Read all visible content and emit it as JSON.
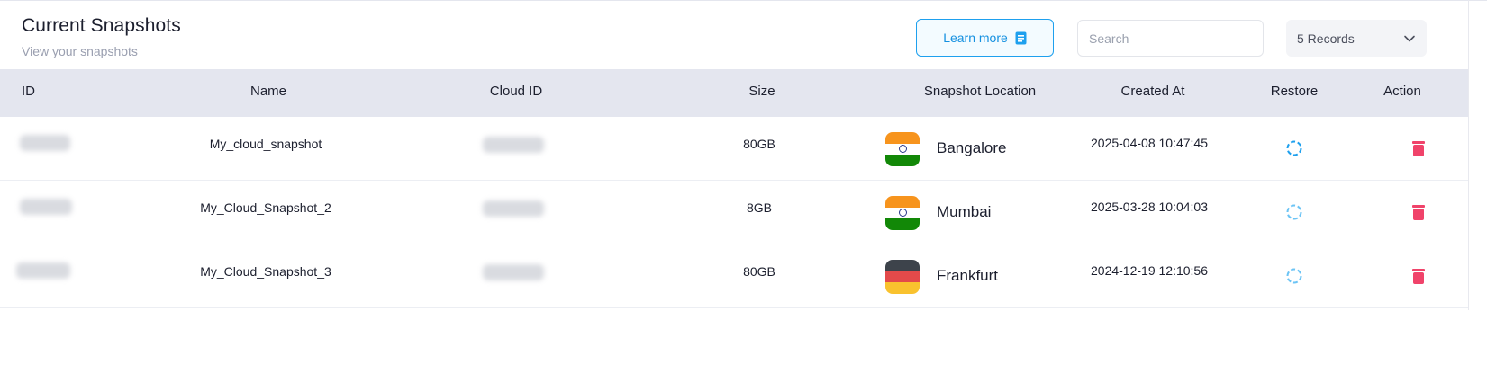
{
  "header": {
    "title": "Current Snapshots",
    "subtitle": "View your snapshots",
    "learn_more_label": "Learn more",
    "search_placeholder": "Search",
    "records_label": "5 Records"
  },
  "table": {
    "columns": [
      "ID",
      "Name",
      "Cloud ID",
      "Size",
      "Snapshot Location",
      "Created At",
      "Restore",
      "Action"
    ],
    "rows": [
      {
        "name": "My_cloud_snapshot",
        "size": "80GB",
        "location": "Bangalore",
        "flag": "india",
        "created_at": "2025-04-08 10:47:45"
      },
      {
        "name": "My_Cloud_Snapshot_2",
        "size": "8GB",
        "location": "Mumbai",
        "flag": "india",
        "created_at": "2025-03-28 10:04:03"
      },
      {
        "name": "My_Cloud_Snapshot_3",
        "size": "80GB",
        "location": "Frankfurt",
        "flag": "germany",
        "created_at": "2024-12-19 12:10:56"
      }
    ]
  },
  "icons": {
    "learn_more": "book-icon",
    "records": "chevron-down-icon",
    "restore": "restore-icon",
    "delete": "trash-icon"
  },
  "colors": {
    "accent": "#1ea0ee",
    "header_bg": "#e4e6ef",
    "delete": "#f0436a"
  }
}
